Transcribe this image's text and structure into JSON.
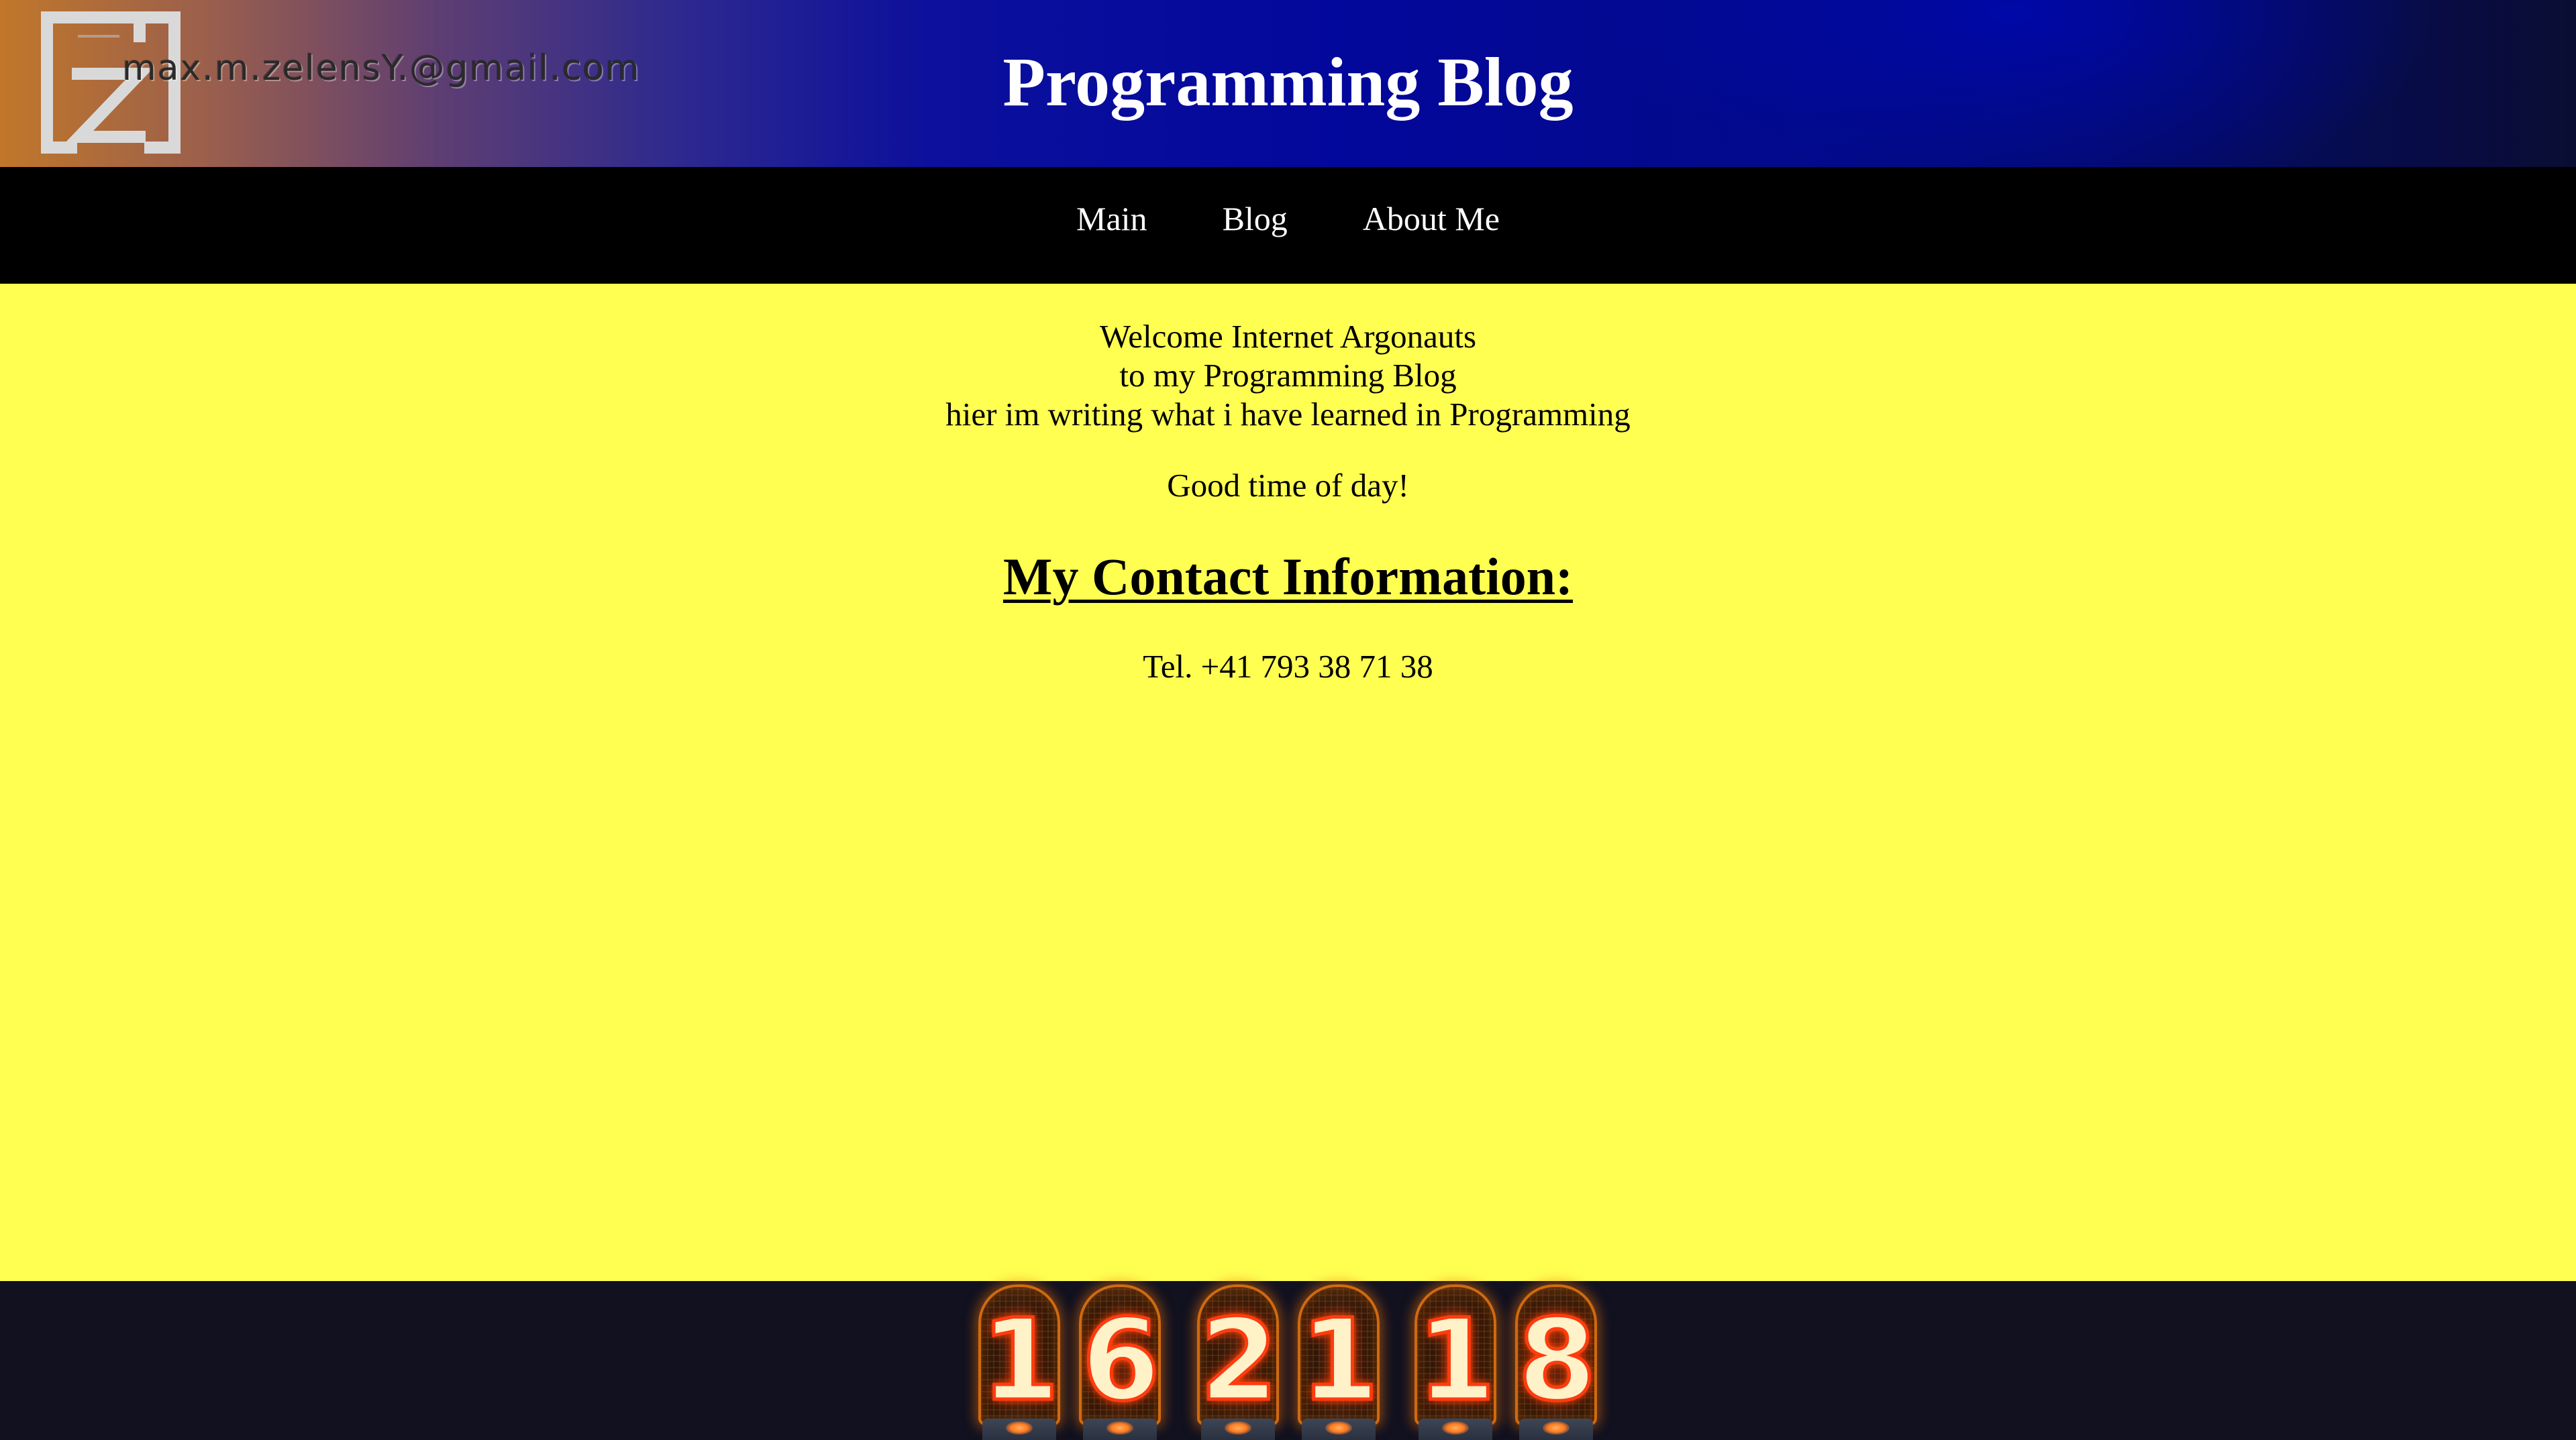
{
  "header": {
    "logo_icon": "mz-monogram-logo-icon",
    "email": "max.m.zelensY.@gmail.com",
    "title": "Programming Blog"
  },
  "nav": {
    "items": [
      {
        "label": "Main"
      },
      {
        "label": "Blog"
      },
      {
        "label": "About Me"
      }
    ]
  },
  "main": {
    "welcome_line_1": "Welcome Internet Argonauts",
    "welcome_line_2": "to my Programming Blog",
    "welcome_line_3": "hier im writing what i have learned in Programming",
    "greeting": "Good time of day!",
    "contact_heading": "My Contact Information:",
    "phone": "Tel. +41 793 38 71 38"
  },
  "footer": {
    "visit_counter": {
      "icon": "nixie-tube-counter-icon",
      "digits": [
        "1",
        "6",
        "2",
        "1",
        "1",
        "8"
      ]
    }
  },
  "colors": {
    "main_background": "#ffff52",
    "nav_background": "#000000",
    "footer_background": "#11111f",
    "header_gradient_start": "#c0772a",
    "header_gradient_mid": "#03089c",
    "header_gradient_end": "#0a0d32"
  }
}
